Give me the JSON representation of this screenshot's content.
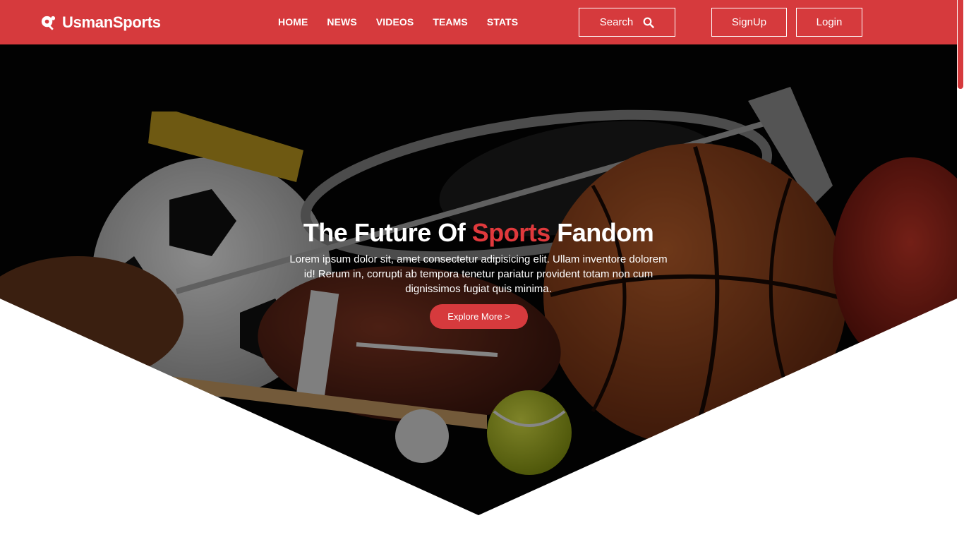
{
  "brand": {
    "name": "UsmanSports",
    "logo_icon": "ping-pong-icon"
  },
  "nav": {
    "links": [
      "HOME",
      "NEWS",
      "VIDEOS",
      "TEAMS",
      "STATS"
    ]
  },
  "search": {
    "label": "Search",
    "icon": "search-icon"
  },
  "auth": {
    "signup_label": "SignUp",
    "login_label": "Login"
  },
  "hero": {
    "title_before": "The Future Of ",
    "title_accent": "Sports",
    "title_after": " Fandom",
    "text": "Lorem ipsum dolor sit, amet consectetur adipisicing elit. Ullam inventore dolorem id! Rerum in, corrupti ab tempora tenetur pariatur provident totam non cum dignissimos fugiat quis minima.",
    "button_label": "Explore More >"
  },
  "colors": {
    "accent": "#d63a3d",
    "text_light": "#ffffff"
  }
}
